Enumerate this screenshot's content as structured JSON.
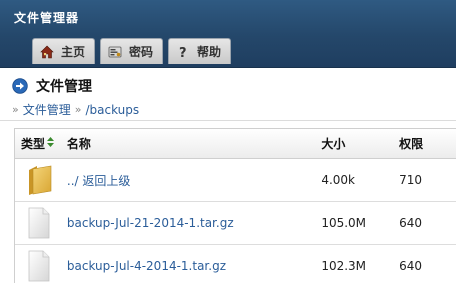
{
  "header": {
    "app_title": "文件管理器",
    "tabs": [
      {
        "label": "主页",
        "icon": "home-icon"
      },
      {
        "label": "密码",
        "icon": "key-icon"
      },
      {
        "label": "帮助",
        "icon": "help-icon"
      }
    ]
  },
  "page": {
    "title": "文件管理",
    "title_icon": "arrow-right-circle-icon"
  },
  "breadcrumb": {
    "separator": "»",
    "root": "文件管理",
    "current": "/backups"
  },
  "table": {
    "columns": {
      "type": "类型",
      "name": "名称",
      "size": "大小",
      "perm": "权限"
    },
    "sort_icon": "sort-arrows-icon",
    "rows": [
      {
        "icon": "folder-icon",
        "name": "../ 返回上级",
        "size": "4.00k",
        "perm": "710"
      },
      {
        "icon": "file-icon",
        "name": "backup-Jul-21-2014-1.tar.gz",
        "size": "105.0M",
        "perm": "640"
      },
      {
        "icon": "file-icon",
        "name": "backup-Jul-4-2014-1.tar.gz",
        "size": "102.3M",
        "perm": "640"
      }
    ]
  },
  "colors": {
    "header_bg": "#24476a",
    "link": "#2b5d99",
    "title_icon": "#2a69b8"
  }
}
